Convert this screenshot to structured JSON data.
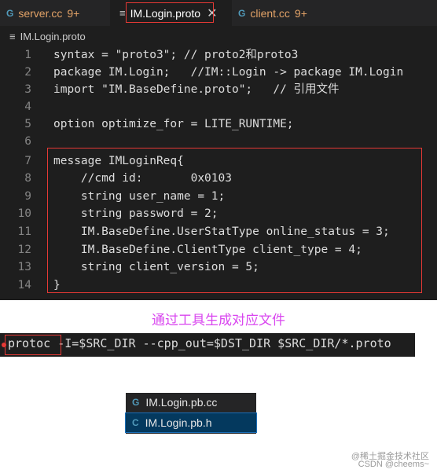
{
  "editor": {
    "tabs": [
      {
        "name": "server.cc",
        "badge": "9+",
        "active": false
      },
      {
        "name": "IM.Login.proto",
        "badge": "",
        "active": true
      },
      {
        "name": "client.cc",
        "badge": "9+",
        "active": false
      }
    ],
    "breadcrumb": "IM.Login.proto",
    "lines": [
      {
        "n": "1",
        "text": "syntax = \"proto3\"; // proto2和proto3"
      },
      {
        "n": "2",
        "text": "package IM.Login;   //IM::Login -> package IM.Login"
      },
      {
        "n": "3",
        "text": "import \"IM.BaseDefine.proto\";   // 引用文件"
      },
      {
        "n": "4",
        "text": ""
      },
      {
        "n": "5",
        "text": "option optimize_for = LITE_RUNTIME;"
      },
      {
        "n": "6",
        "text": ""
      },
      {
        "n": "7",
        "text": "message IMLoginReq{"
      },
      {
        "n": "8",
        "text": "    //cmd id:       0x0103"
      },
      {
        "n": "9",
        "text": "    string user_name = 1;"
      },
      {
        "n": "10",
        "text": "    string password = 2;"
      },
      {
        "n": "11",
        "text": "    IM.BaseDefine.UserStatType online_status = 3;"
      },
      {
        "n": "12",
        "text": "    IM.BaseDefine.ClientType client_type = 4;"
      },
      {
        "n": "13",
        "text": "    string client_version = 5;"
      },
      {
        "n": "14",
        "text": "}"
      }
    ]
  },
  "caption": "通过工具生成对应文件",
  "terminal": {
    "command_name": "protoc",
    "command_args": " -I=$SRC_DIR --cpp_out=$DST_DIR $SRC_DIR/*.proto"
  },
  "files": [
    {
      "name": "IM.Login.pb.cc",
      "icon": "G"
    },
    {
      "name": "IM.Login.pb.h",
      "icon": "C"
    }
  ],
  "watermark": {
    "line1": "@稀土掘金技术社区",
    "line2": "CSDN @cheems~"
  },
  "colors": {
    "highlight": "#e53935",
    "caption": "#d946ef",
    "tab_modified": "#e2a267"
  }
}
